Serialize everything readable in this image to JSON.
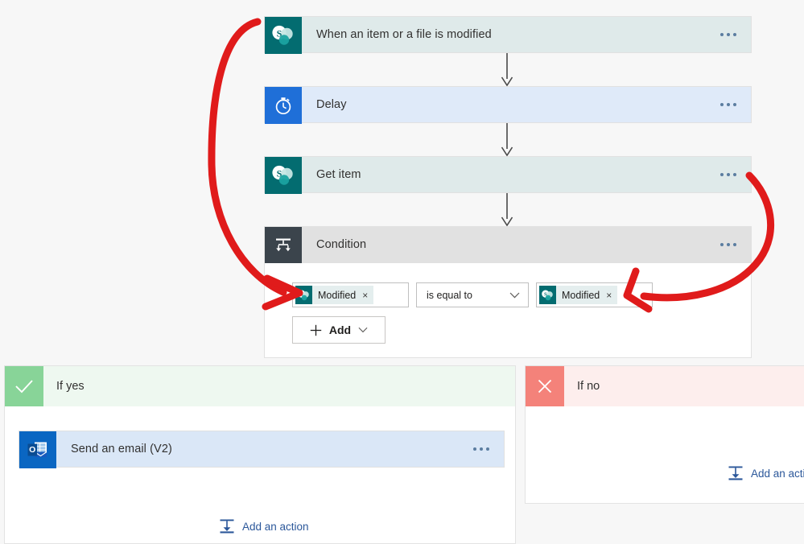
{
  "canvas": {
    "background": "#f7f7f7",
    "annotation_color": "#e01b1b"
  },
  "flow": {
    "cards": [
      {
        "id": "trigger-sharepoint",
        "title": "When an item or a file is modified",
        "icon": "sharepoint-icon",
        "variant": "c-sharepoint",
        "menu": "ellipsis-menu",
        "body_color": "#dfeaea",
        "icon_color": "#036c70"
      },
      {
        "id": "action-delay",
        "title": "Delay",
        "icon": "stopwatch-icon",
        "variant": "c-delay",
        "menu": "ellipsis-menu",
        "body_color": "#dfeaf9",
        "icon_color": "#1f6fd8"
      },
      {
        "id": "action-get-item",
        "title": "Get item",
        "icon": "sharepoint-icon",
        "variant": "c-sharepoint",
        "menu": "ellipsis-menu",
        "body_color": "#dfeaea",
        "icon_color": "#036c70"
      },
      {
        "id": "action-condition",
        "title": "Condition",
        "icon": "condition-branch-icon",
        "variant": "c-condition",
        "menu": "ellipsis-menu",
        "body_color": "#e1e1e1",
        "icon_color": "#3b444c"
      }
    ]
  },
  "condition": {
    "left_token": {
      "label": "Modified",
      "icon": "sharepoint-icon",
      "remove": "×"
    },
    "operator": {
      "value": "is equal to",
      "chevron": "chevron-down-icon"
    },
    "right_token": {
      "label": "Modified",
      "icon": "sharepoint-icon",
      "remove": "×"
    },
    "add_button": {
      "label": "Add",
      "plus": "plus-icon",
      "chevron": "chevron-down-icon"
    }
  },
  "branches": {
    "yes": {
      "label": "If yes",
      "icon": "checkmark-icon",
      "icon_color": "#88d498",
      "header_color": "#eef8f0",
      "action_card": {
        "title": "Send an email (V2)",
        "icon": "outlook-icon",
        "variant": "c-outlook",
        "menu": "ellipsis-menu",
        "body_color": "#dae7f7",
        "icon_color": "#0a66c2"
      },
      "add_action": {
        "label": "Add an action",
        "icon": "add-action-icon"
      }
    },
    "no": {
      "label": "If no",
      "icon": "close-x-icon",
      "icon_color": "#f4827a",
      "header_color": "#fdeeed",
      "add_action": {
        "label": "Add an actio",
        "icon": "add-action-icon"
      }
    }
  }
}
